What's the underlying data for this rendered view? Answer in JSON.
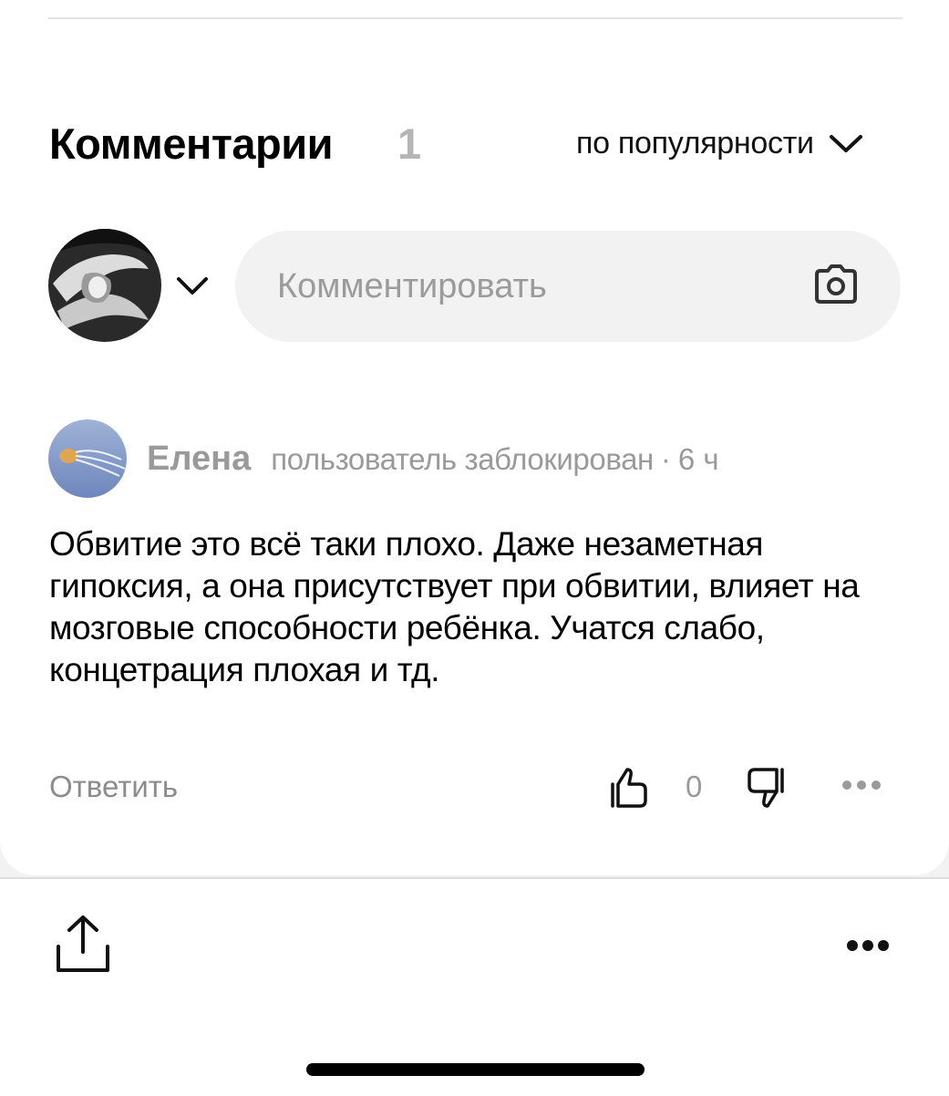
{
  "comments": {
    "title": "Комментарии",
    "count": "1",
    "sort_label": "по популярности",
    "input_placeholder": "Комментировать"
  },
  "comment": {
    "author": "Елена",
    "status": "пользователь заблокирован",
    "separator": "·",
    "time": "6 ч",
    "text": "Обвитие это всё таки плохо. Даже незаметная гипоксия, а она присутствует при обвитии, влияет на мозговые способности ребёнка. Учатся слабо, концетрация плохая и тд.",
    "reply_label": "Ответить",
    "likes": "0"
  },
  "icons": {
    "sort": "chevron-down-icon",
    "account": "chevron-down-icon",
    "attach": "camera-icon",
    "like": "thumbs-up-icon",
    "dislike": "thumbs-down-icon",
    "more": "more-horizontal-icon",
    "share": "share-icon"
  }
}
